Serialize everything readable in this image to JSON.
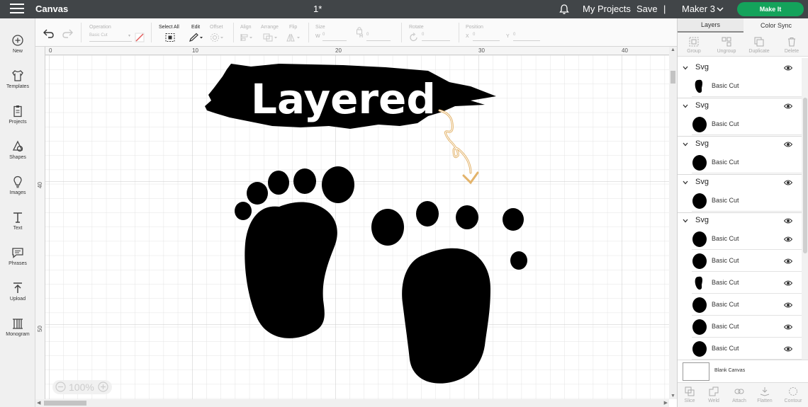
{
  "topbar": {
    "app_title": "Canvas",
    "doc_title": "1*",
    "my_projects": "My Projects",
    "save": "Save",
    "divider": "|",
    "machine": "Maker 3",
    "make_it": "Make It",
    "bell_icon": "bell-icon"
  },
  "left_nav": [
    {
      "label": "New",
      "icon": "plus-circle-icon"
    },
    {
      "label": "Templates",
      "icon": "shirt-icon"
    },
    {
      "label": "Projects",
      "icon": "clipboard-icon"
    },
    {
      "label": "Shapes",
      "icon": "shapes-icon"
    },
    {
      "label": "Images",
      "icon": "bulb-icon"
    },
    {
      "label": "Text",
      "icon": "text-icon"
    },
    {
      "label": "Phrases",
      "icon": "speech-icon"
    },
    {
      "label": "Upload",
      "icon": "upload-icon"
    },
    {
      "label": "Monogram",
      "icon": "monogram-icon"
    }
  ],
  "toolbar": {
    "operation_label": "Operation",
    "operation_value": "Basic Cut",
    "select_all": "Select All",
    "edit": "Edit",
    "offset": "Offset",
    "align": "Align",
    "arrange": "Arrange",
    "flip": "Flip",
    "size": "Size",
    "w": "W",
    "h": "H",
    "w_value": "0",
    "h_value": "0",
    "rotate": "Rotate",
    "rotate_value": "0",
    "position": "Position",
    "x": "X",
    "y": "Y",
    "x_value": "0",
    "y_value": "0"
  },
  "ruler": {
    "top": [
      "0",
      "10",
      "20",
      "30",
      "40"
    ],
    "left": [
      "40",
      "50"
    ]
  },
  "canvas": {
    "banner_text": "Layered",
    "zoom": "100%"
  },
  "right_panel": {
    "tabs": [
      "Layers",
      "Color Sync"
    ],
    "actions": [
      "Group",
      "Ungroup",
      "Duplicate",
      "Delete"
    ],
    "groups": [
      {
        "name": "Svg",
        "layers": [
          "Basic Cut"
        ]
      },
      {
        "name": "Svg",
        "layers": [
          "Basic Cut"
        ]
      },
      {
        "name": "Svg",
        "layers": [
          "Basic Cut"
        ]
      },
      {
        "name": "Svg",
        "layers": [
          "Basic Cut"
        ]
      },
      {
        "name": "Svg",
        "layers": [
          "Basic Cut",
          "Basic Cut",
          "Basic Cut",
          "Basic Cut",
          "Basic Cut",
          "Basic Cut"
        ]
      }
    ],
    "blank_canvas": "Blank Canvas",
    "bottom_actions": [
      "Slice",
      "Weld",
      "Attach",
      "Flatten",
      "Contour"
    ]
  },
  "colors": {
    "topbar_bg": "#414548",
    "make_it_green": "#14a35b",
    "arrow_gold": "#e3b36a"
  }
}
